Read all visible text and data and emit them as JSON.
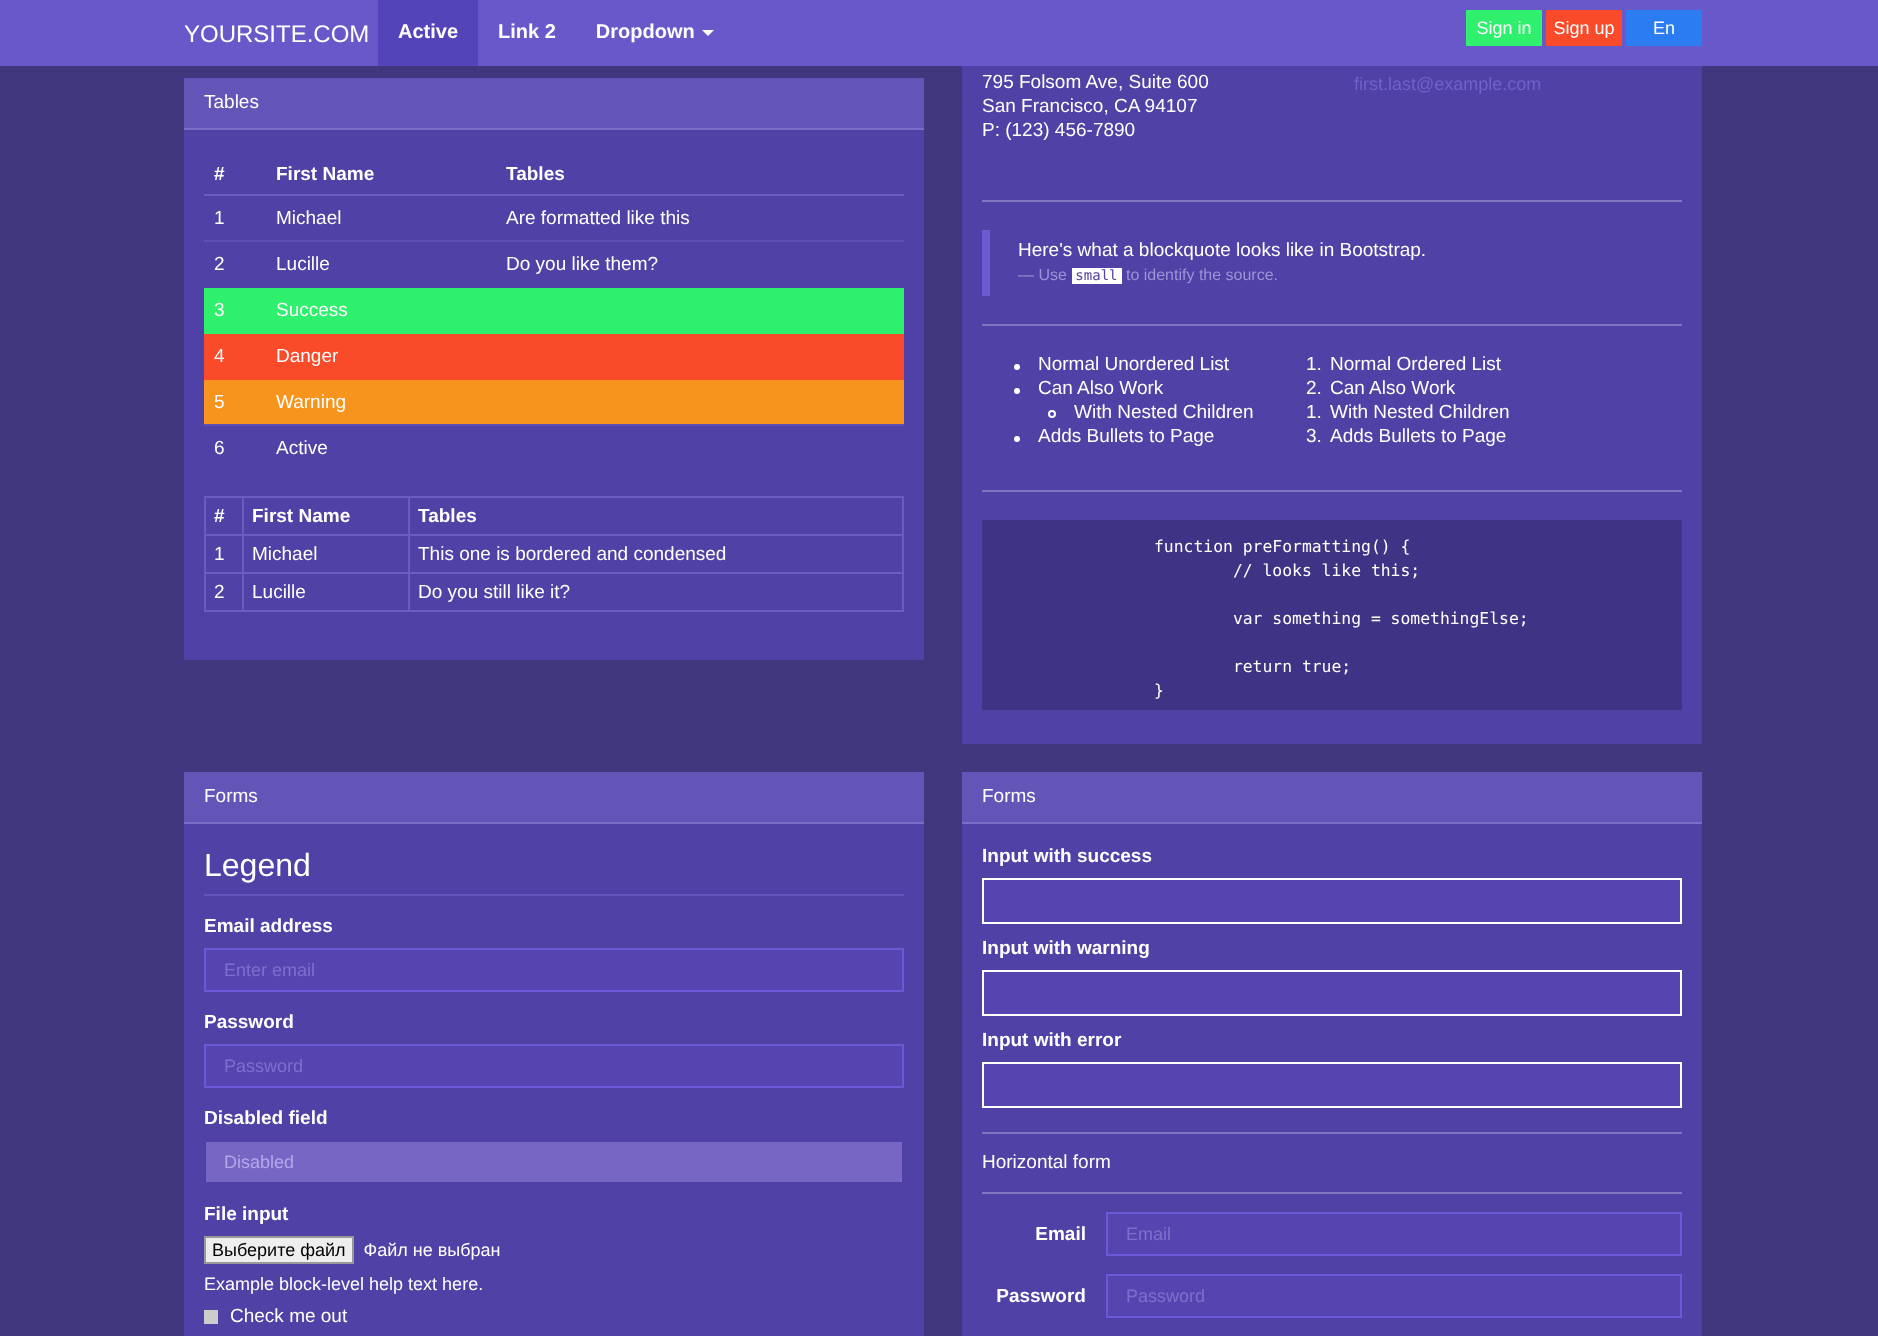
{
  "navbar": {
    "brand": "YOURSITE.COM",
    "links": [
      {
        "label": "Active",
        "selected": true,
        "dropdown": false
      },
      {
        "label": "Link 2",
        "selected": false,
        "dropdown": false
      },
      {
        "label": "Dropdown",
        "selected": false,
        "dropdown": true
      }
    ],
    "buttons": [
      {
        "label": "Sign in",
        "color": "#2ef06c"
      },
      {
        "label": "Sign up",
        "color": "#f94a2a"
      },
      {
        "label": "En",
        "color": "#2a7cf0"
      }
    ]
  },
  "tables_panel": {
    "title": "Tables",
    "table": {
      "columns": [
        "#",
        "First Name",
        "Tables"
      ],
      "rows": [
        {
          "kind": "default",
          "cells": [
            "1",
            "Michael",
            "Are formatted like this"
          ]
        },
        {
          "kind": "default",
          "cells": [
            "2",
            "Lucille",
            "Do you like them?"
          ]
        },
        {
          "kind": "success",
          "cells": [
            "3",
            "Success",
            ""
          ]
        },
        {
          "kind": "danger",
          "cells": [
            "4",
            "Danger",
            ""
          ]
        },
        {
          "kind": "warning",
          "cells": [
            "5",
            "Warning",
            ""
          ]
        },
        {
          "kind": "active",
          "cells": [
            "6",
            "Active",
            ""
          ]
        }
      ]
    },
    "condensed_table": {
      "columns": [
        "#",
        "First Name",
        "Tables"
      ],
      "rows": [
        {
          "cells": [
            "1",
            "Michael",
            "This one is bordered and condensed"
          ]
        },
        {
          "cells": [
            "2",
            "Lucille",
            "Do you still like it?"
          ]
        }
      ]
    }
  },
  "typography_panel": {
    "address": [
      "795 Folsom Ave, Suite 600",
      "San Francisco, CA 94107",
      "P: (123) 456-7890"
    ],
    "email": "first.last@example.com",
    "blockquote": {
      "text": "Here's what a blockquote looks like in Bootstrap.",
      "source_before": "— Use",
      "source_code": "small",
      "source_after": "to identify the source."
    },
    "unordered_list": [
      {
        "text": "Normal Unordered List"
      },
      {
        "text": "Can Also Work",
        "children": [
          {
            "text": "With Nested Children"
          }
        ]
      },
      {
        "text": "Adds Bullets to Page"
      }
    ],
    "ordered_list": [
      {
        "marker": "1.",
        "text": "Normal Ordered List"
      },
      {
        "marker": "2.",
        "text": "Can Also Work",
        "children": [
          {
            "marker": "1.",
            "text": "With Nested Children"
          }
        ]
      },
      {
        "marker": "3.",
        "text": "Adds Bullets to Page"
      }
    ],
    "code": "function preFormatting() {\n\t// looks like this;\n\n\tvar something = somethingElse;\n\n\treturn true;\n}"
  },
  "forms_panel": {
    "title": "Forms",
    "legend": "Legend",
    "fields": [
      {
        "kind": "text",
        "label": "Email address",
        "placeholder": "Enter email"
      },
      {
        "kind": "password",
        "label": "Password",
        "placeholder": "Password"
      },
      {
        "kind": "disabled",
        "label": "Disabled field",
        "placeholder": "Disabled"
      },
      {
        "kind": "file",
        "label": "File input",
        "button": "Выберите файл",
        "status": "Файл не выбран",
        "help": "Example block-level help text here."
      },
      {
        "kind": "checkbox",
        "label": "Check me out",
        "checked": false
      }
    ]
  },
  "validation_panel": {
    "title": "Forms",
    "fields": [
      {
        "label": "Input with success"
      },
      {
        "label": "Input with warning"
      },
      {
        "label": "Input with error"
      }
    ],
    "horizontal_title": "Horizontal form",
    "horizontal_fields": [
      {
        "label": "Email",
        "placeholder": "Email"
      },
      {
        "label": "Password",
        "placeholder": "Password"
      }
    ]
  }
}
